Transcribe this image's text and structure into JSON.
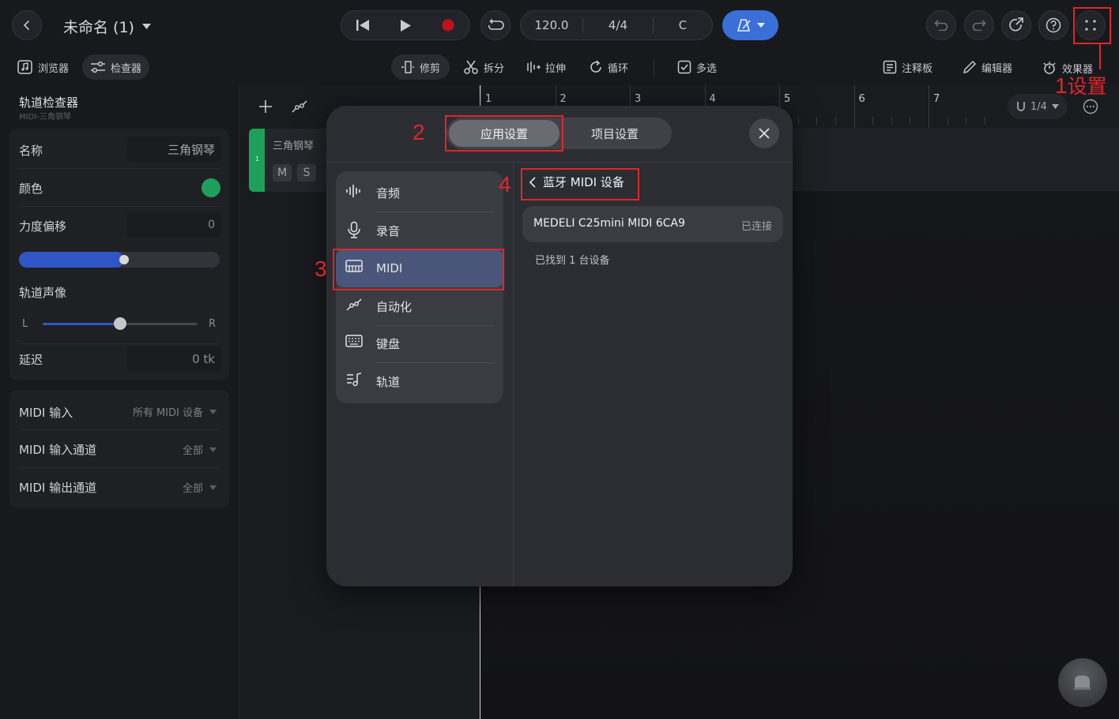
{
  "header": {
    "project_title": "未命名 (1)",
    "tempo": "120.0",
    "time_signature": "4/4",
    "key": "C"
  },
  "toolbar": {
    "browser": "浏览器",
    "inspector": "检查器",
    "trim": "修剪",
    "split": "拆分",
    "stretch": "拉伸",
    "loop": "循环",
    "multiselect": "多选",
    "notepad": "注释板",
    "editor": "编辑器",
    "effects": "效果器"
  },
  "inspector": {
    "title": "轨道检查器",
    "subtitle": "MIDI-三角钢琴",
    "name_label": "名称",
    "name_value": "三角钢琴",
    "color_label": "颜色",
    "velocity_label": "力度偏移",
    "velocity_value": "0",
    "velocity_slider_level": 0.5,
    "pan_label": "轨道声像",
    "pan_left": "L",
    "pan_right": "R",
    "pan_level": 0.5,
    "delay_label": "延迟",
    "delay_value": "0 tk",
    "midi_in_label": "MIDI 输入",
    "midi_in_value": "所有 MIDI 设备",
    "midi_in_ch_label": "MIDI 输入通道",
    "midi_in_ch_value": "全部",
    "midi_out_ch_label": "MIDI 输出通道",
    "midi_out_ch_value": "全部"
  },
  "track": {
    "number": "1",
    "name": "三角钢琴",
    "mute": "M",
    "solo": "S"
  },
  "timeline": {
    "bars": [
      "1",
      "2",
      "3",
      "4",
      "5",
      "6",
      "7"
    ],
    "snap": "1/4"
  },
  "modal": {
    "tab_app": "应用设置",
    "tab_project": "项目设置",
    "nav": [
      {
        "label": "音频",
        "icon": "audio-wave-icon"
      },
      {
        "label": "录音",
        "icon": "microphone-icon"
      },
      {
        "label": "MIDI",
        "icon": "midi-keyboard-icon"
      },
      {
        "label": "自动化",
        "icon": "automation-icon"
      },
      {
        "label": "键盘",
        "icon": "keyboard-icon"
      },
      {
        "label": "轨道",
        "icon": "track-list-icon"
      }
    ],
    "back_title": "蓝牙 MIDI 设备",
    "device_name": "MEDELI C25mini MIDI 6CA9",
    "device_status": "已连接",
    "found_text": "已找到 1 台设备"
  },
  "annotations": {
    "n1": "1",
    "n1_text": "设置",
    "n2": "2",
    "n3": "3",
    "n4": "4"
  },
  "colors": {
    "accent_blue": "#3a6fd8",
    "track_green": "#1fa05a",
    "record_red": "#c0121a",
    "annotation_red": "#e0262a"
  }
}
